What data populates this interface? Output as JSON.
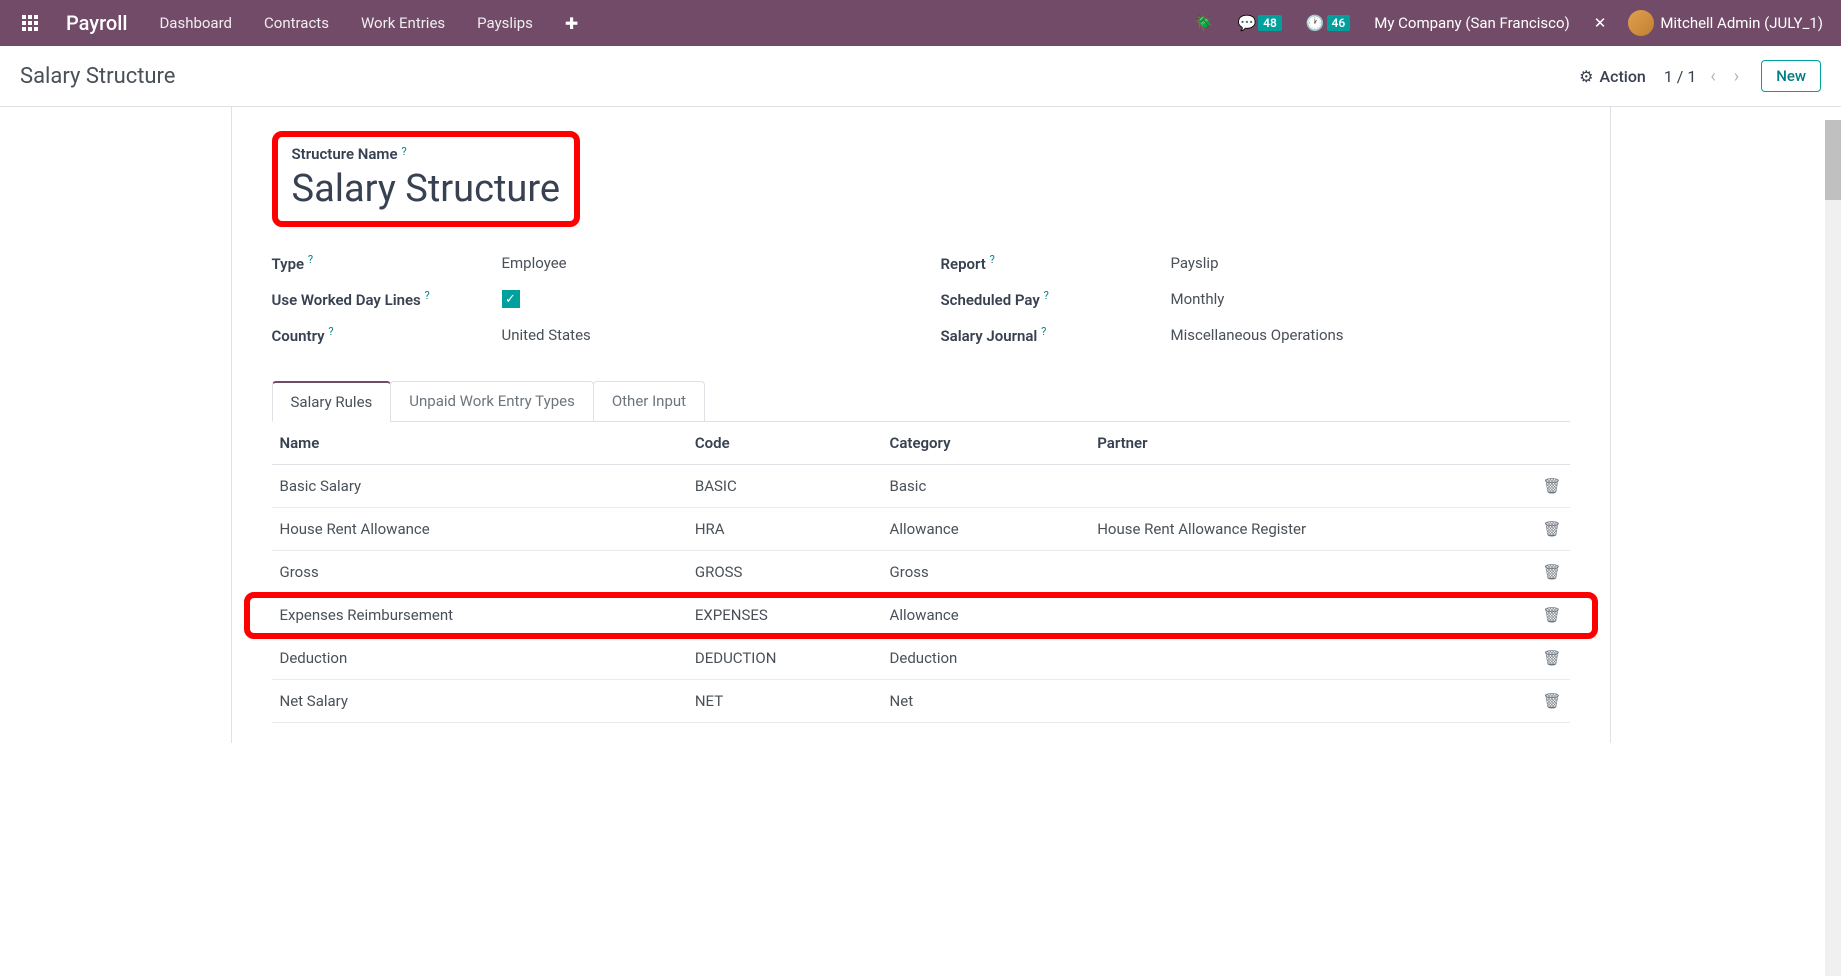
{
  "navbar": {
    "brand": "Payroll",
    "items": [
      "Dashboard",
      "Contracts",
      "Work Entries",
      "Payslips"
    ],
    "messages_badge": "48",
    "activities_badge": "46",
    "company": "My Company (San Francisco)",
    "user": "Mitchell Admin (JULY_1)"
  },
  "subheader": {
    "title": "Salary Structure",
    "action_label": "Action",
    "pager": "1 / 1",
    "new_label": "New"
  },
  "form": {
    "structure_name_label": "Structure Name",
    "structure_name_value": "Salary Structure",
    "type_label": "Type",
    "type_value": "Employee",
    "worked_day_label": "Use Worked Day Lines",
    "country_label": "Country",
    "country_value": "United States",
    "report_label": "Report",
    "report_value": "Payslip",
    "scheduled_pay_label": "Scheduled Pay",
    "scheduled_pay_value": "Monthly",
    "salary_journal_label": "Salary Journal",
    "salary_journal_value": "Miscellaneous Operations"
  },
  "tabs": [
    "Salary Rules",
    "Unpaid Work Entry Types",
    "Other Input"
  ],
  "table": {
    "headers": [
      "Name",
      "Code",
      "Category",
      "Partner"
    ],
    "rows": [
      {
        "name": "Basic Salary",
        "code": "BASIC",
        "category": "Basic",
        "partner": ""
      },
      {
        "name": "House Rent Allowance",
        "code": "HRA",
        "category": "Allowance",
        "partner": "House Rent Allowance Register"
      },
      {
        "name": "Gross",
        "code": "GROSS",
        "category": "Gross",
        "partner": ""
      },
      {
        "name": "Expenses Reimbursement",
        "code": "EXPENSES",
        "category": "Allowance",
        "partner": ""
      },
      {
        "name": "Deduction",
        "code": "DEDUCTION",
        "category": "Deduction",
        "partner": ""
      },
      {
        "name": "Net Salary",
        "code": "NET",
        "category": "Net",
        "partner": ""
      }
    ]
  }
}
